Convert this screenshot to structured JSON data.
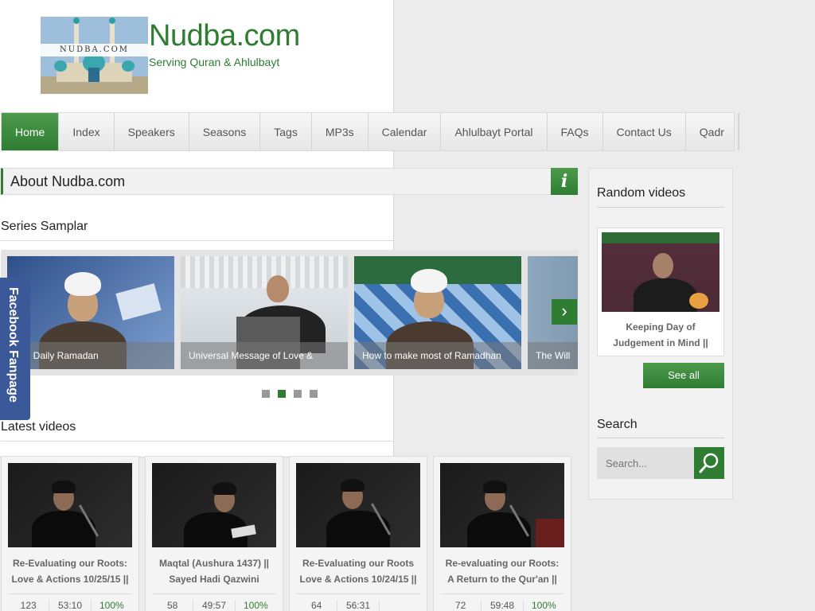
{
  "header": {
    "logo_text": "NUDBA.COM",
    "site_title": "Nudba.com",
    "tagline": "Serving Quran & Ahlulbayt"
  },
  "nav": {
    "items": [
      {
        "label": "Home",
        "active": true
      },
      {
        "label": "Index"
      },
      {
        "label": "Speakers"
      },
      {
        "label": "Seasons"
      },
      {
        "label": "Tags"
      },
      {
        "label": "MP3s"
      },
      {
        "label": "Calendar"
      },
      {
        "label": "Ahlulbayt Portal"
      },
      {
        "label": "FAQs"
      },
      {
        "label": "Contact Us"
      },
      {
        "label": "Qadr"
      }
    ]
  },
  "about": {
    "title": "About Nudba.com",
    "icon": "info-icon"
  },
  "series": {
    "title": "Series Samplar",
    "slides": [
      {
        "caption": "y 1] Daily Ramadan"
      },
      {
        "caption": "Universal Message of Love &"
      },
      {
        "caption": "How to make most of Ramadhan"
      },
      {
        "caption": "The Will"
      }
    ],
    "next_label": "›",
    "dots_active": 2
  },
  "facebook": {
    "label": "Facebook Fanpage"
  },
  "latest": {
    "title": "Latest videos",
    "videos": [
      {
        "title_line1": "Re-Evaluating our Roots:",
        "title_line2": "Love & Actions 10/25/15 ||",
        "views": "123",
        "duration": "53:10",
        "rating": "100%"
      },
      {
        "title_line1": "Maqtal (Aushura 1437) ||",
        "title_line2": "Sayed Hadi Qazwini",
        "views": "58",
        "duration": "49:57",
        "rating": "100%"
      },
      {
        "title_line1": "Re-Evaluating our Roots",
        "title_line2": "Love & Actions 10/24/15 ||",
        "views": "64",
        "duration": "56:31",
        "rating": ""
      },
      {
        "title_line1": "Re-evaluating our Roots:",
        "title_line2": "A Return to the Qur'an ||",
        "views": "72",
        "duration": "59:48",
        "rating": "100%"
      }
    ]
  },
  "sidebar": {
    "random_title": "Random videos",
    "random_video": {
      "title_line1": "Keeping Day of",
      "title_line2": "Judgement in Mind ||"
    },
    "see_all_label": "See all",
    "search_title": "Search",
    "search_placeholder": "Search..."
  },
  "colors": {
    "accent": "#2e7d32",
    "facebook": "#3b5998"
  }
}
